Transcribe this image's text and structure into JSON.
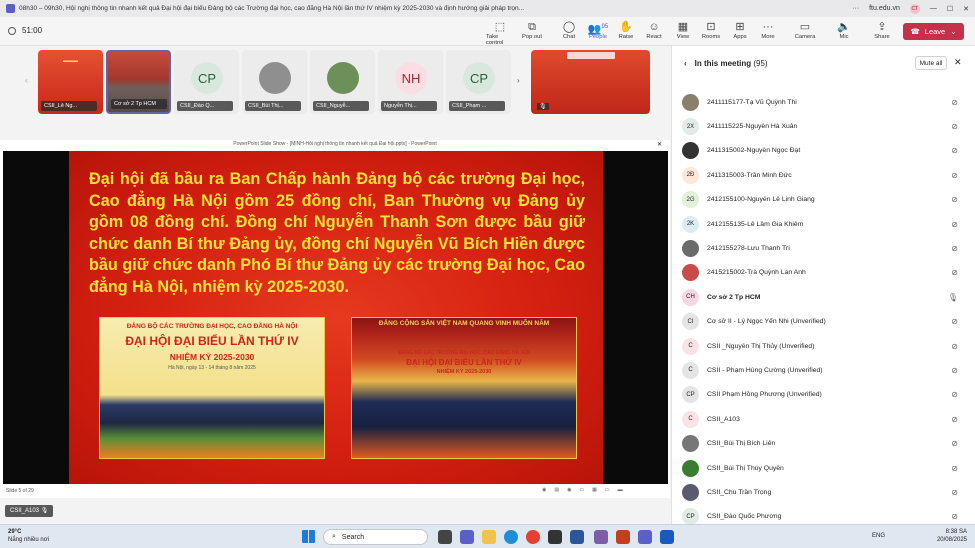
{
  "window": {
    "title": "08h30 – 09h30, Hội nghị thông tin nhanh kết quả Đại hội đại biểu Đảng bộ các Trường đại học, cao đẳng Hà Nội lần thứ IV nhiệm kỳ 2025-2030 và định hướng giải pháp trọn...",
    "domain": "ftu.edu.vn",
    "user_initials": "CT"
  },
  "toolbar": {
    "timer": "51:00",
    "take_control": "Take control",
    "pop_out": "Pop out",
    "chat": "Chat",
    "people": "People",
    "people_count": "95",
    "raise": "Raise",
    "react": "React",
    "view": "View",
    "rooms": "Rooms",
    "apps": "Apps",
    "more": "More",
    "camera": "Camera",
    "mic": "Mic",
    "share": "Share",
    "leave": "Leave"
  },
  "tiles": [
    {
      "label": "CSII_Lê Ng...",
      "initials": ""
    },
    {
      "label": "Cơ sở 2 Tp HCM",
      "initials": ""
    },
    {
      "label": "CSII_Đào Q...",
      "initials": "CP"
    },
    {
      "label": "CSII_Bùi Thị...",
      "initials": ""
    },
    {
      "label": "CSII_Nguyễ...",
      "initials": ""
    },
    {
      "label": "Nguyễn Thị...",
      "initials": "NH"
    },
    {
      "label": "CSII_Phạm ...",
      "initials": "CP"
    }
  ],
  "ppt": {
    "window_title": "PowerPoint Slide Show - [MINH-Hội nghị thông tin nhanh kết quả Đại hội.pptx] - PowerPoint",
    "slide_text": "Đại hội đã bầu ra Ban Chấp hành Đảng bộ các trường Đại học, Cao đẳng Hà Nội gồm 25 đồng chí, Ban Thường vụ Đảng ủy gồm 08 đồng chí. Đồng chí Nguyễn Thanh Sơn được bầu giữ chức danh Bí thư Đảng ủy, đồng chí Nguyễn Vũ Bích Hiền được bầu giữ chức danh Phó Bí thư Đảng ủy các trường Đại học, Cao đẳng Hà Nội, nhiệm kỳ 2025-2030.",
    "photo1_line1": "ĐẢNG BỘ CÁC TRƯỜNG ĐẠI HỌC, CAO ĐẲNG HÀ NỘI",
    "photo1_line2": "ĐẠI HỘI ĐẠI BIỂU LẦN THỨ IV",
    "photo1_line3": "NHIỆM KỲ 2025-2030",
    "photo1_line4": "Hà Nội, ngày 13 - 14 tháng 8 năm 2025",
    "photo2_banner": "ĐẢNG CỘNG SẢN VIỆT NAM QUANG VINH MUÔN NĂM",
    "photo2_line1": "ĐẢNG BỘ CÁC TRƯỜNG ĐẠI HỌC, CAO ĐẲNG HÀ NỘI",
    "photo2_line2": "ĐẠI HỘI ĐẠI BIỂU LẦN THỨ IV",
    "photo2_line3": "NHIỆM KỲ 2025-2030",
    "slide_counter": "Slide 5 of 29"
  },
  "self_label": "CSII_A103",
  "panel": {
    "title": "In this meeting",
    "count": "(95)",
    "mute_all": "Mute all",
    "participants": [
      {
        "name": "2411115177-Tạ Vũ Quỳnh Thi",
        "initials": "",
        "bg": "#8a7f6b",
        "muted": true
      },
      {
        "name": "2411115225-Nguyễn Hà Xuân",
        "initials": "2X",
        "bg": "#e1ece4",
        "muted": true
      },
      {
        "name": "2411315002-Nguyễn Ngọc Đạt",
        "initials": "",
        "bg": "#333333",
        "muted": true
      },
      {
        "name": "2411315003-Trần Minh Đức",
        "initials": "2Đ",
        "bg": "#fde7d7",
        "muted": true
      },
      {
        "name": "2412155100-Nguyễn Lê Linh Giang",
        "initials": "2G",
        "bg": "#e2efd9",
        "muted": true
      },
      {
        "name": "2412155135-Lê Lâm Gia Khiêm",
        "initials": "2K",
        "bg": "#dcecf3",
        "muted": true
      },
      {
        "name": "2412155278-Lưu Thanh Trí",
        "initials": "",
        "bg": "#6b6b6b",
        "muted": true
      },
      {
        "name": "2415215002-Trà Quỳnh Lan Anh",
        "initials": "",
        "bg": "#c94b4b",
        "muted": true
      },
      {
        "name": "Cơ sở 2 Tp HCM",
        "initials": "CH",
        "bg": "#f7d7e4",
        "muted": false
      },
      {
        "name": "Cơ sở II - Lý Ngọc Yến Nhi (Unverified)",
        "initials": "CI",
        "bg": "#e4e4e4",
        "muted": true
      },
      {
        "name": "CSII _Nguyễn Thị Thủy (Unverified)",
        "initials": "C",
        "bg": "#fbe2e6",
        "muted": true
      },
      {
        "name": "CSII - Phạm Hùng Cường (Unverified)",
        "initials": "C",
        "bg": "#e4e4e4",
        "muted": true
      },
      {
        "name": "CSII Phạm Hồng Phương (Unverified)",
        "initials": "CP",
        "bg": "#e4e4e4",
        "muted": true
      },
      {
        "name": "CSII_A103",
        "initials": "C",
        "bg": "#fbe2e6",
        "muted": true
      },
      {
        "name": "CSII_Bùi Thị Bích Liên",
        "initials": "",
        "bg": "#777777",
        "muted": true
      },
      {
        "name": "CSII_Bùi Thị Thúy Quyên",
        "initials": "",
        "bg": "#3b7d2f",
        "muted": true
      },
      {
        "name": "CSII_Chu Trần Trọng",
        "initials": "",
        "bg": "#5a5a70",
        "muted": true
      },
      {
        "name": "CSII_Đào Quốc Phương",
        "initials": "CP",
        "bg": "#e1ece4",
        "muted": true
      }
    ]
  },
  "taskbar": {
    "temp": "29°C",
    "weather": "Nắng nhiều nơi",
    "search": "Search",
    "lang": "ENG",
    "time": "8:38 SA",
    "date": "20/08/2025"
  }
}
